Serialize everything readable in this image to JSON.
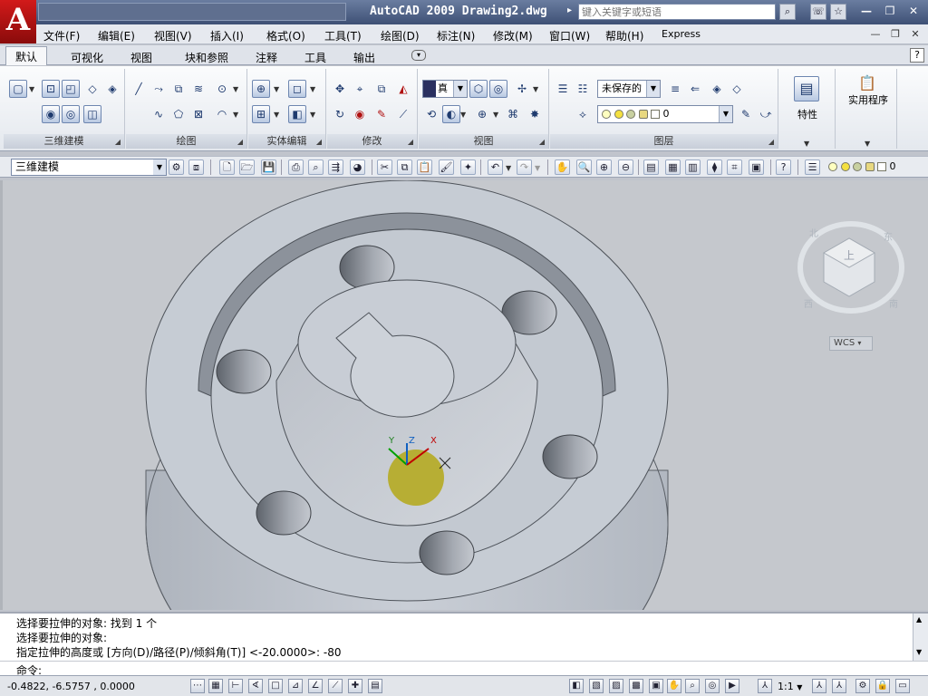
{
  "app": {
    "window_title": "AutoCAD 2009  Drawing2.dwg",
    "search_placeholder": "键入关键字或短语",
    "logo_letter": "A"
  },
  "menu": {
    "items": [
      "文件(F)",
      "编辑(E)",
      "视图(V)",
      "插入(I)",
      "格式(O)",
      "工具(T)",
      "绘图(D)",
      "标注(N)",
      "修改(M)",
      "窗口(W)",
      "帮助(H)",
      "Express"
    ]
  },
  "ribbon_tabs": [
    "默认",
    "可视化",
    "视图",
    "块和参照",
    "注释",
    "工具",
    "输出"
  ],
  "ribbon_panels": {
    "modeling": "三维建模",
    "draw": "绘图",
    "solid_edit": "实体编辑",
    "modify": "修改",
    "view": "视图",
    "layers": "图层",
    "properties": "特性",
    "utilities": "实用程序",
    "view_style": "真",
    "layer_state": "未保存的",
    "layer_name": "0"
  },
  "toolbar": {
    "workspace": "三维建模",
    "layer_name": "0"
  },
  "viewport": {
    "ucs_labels": {
      "y": "Y",
      "z": "Z",
      "x": "X"
    },
    "viewcube": {
      "top": "上",
      "south": "南",
      "west": "西",
      "east": "东",
      "north": "北"
    },
    "wcs_label": "WCS"
  },
  "command": {
    "history": [
      "选择要拉伸的对象: 找到 1 个",
      "选择要拉伸的对象:",
      "指定拉伸的高度或 [方向(D)/路径(P)/倾斜角(T)] <-20.0000>: -80"
    ],
    "prompt": "命令:"
  },
  "statusbar": {
    "coordinates": "-0.4822,  -6.5757 , 0.0000",
    "annotation_scale": "1:1"
  },
  "colors": {
    "title_bar": "#3e5075",
    "model_face": "#c6ccd4",
    "ucs_x": "#c00000",
    "ucs_y": "#00a000",
    "ucs_z": "#1060c0"
  }
}
